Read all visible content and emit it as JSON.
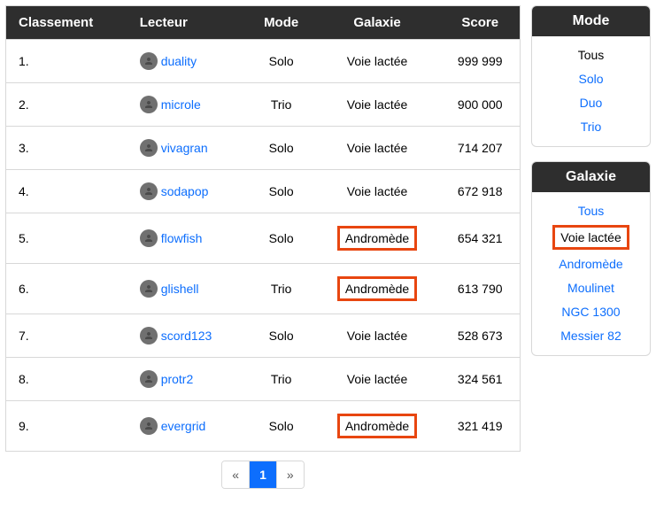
{
  "headers": [
    "Classement",
    "Lecteur",
    "Mode",
    "Galaxie",
    "Score"
  ],
  "rows": [
    {
      "rank": "1.",
      "player": "duality",
      "mode": "Solo",
      "galaxy": "Voie lactée",
      "galaxyHighlighted": false,
      "score": "999 999"
    },
    {
      "rank": "2.",
      "player": "microle",
      "mode": "Trio",
      "galaxy": "Voie lactée",
      "galaxyHighlighted": false,
      "score": "900 000"
    },
    {
      "rank": "3.",
      "player": "vivagran",
      "mode": "Solo",
      "galaxy": "Voie lactée",
      "galaxyHighlighted": false,
      "score": "714 207"
    },
    {
      "rank": "4.",
      "player": "sodapop",
      "mode": "Solo",
      "galaxy": "Voie lactée",
      "galaxyHighlighted": false,
      "score": "672 918"
    },
    {
      "rank": "5.",
      "player": "flowfish",
      "mode": "Solo",
      "galaxy": "Andromède",
      "galaxyHighlighted": true,
      "score": "654 321"
    },
    {
      "rank": "6.",
      "player": "glishell",
      "mode": "Trio",
      "galaxy": "Andromède",
      "galaxyHighlighted": true,
      "score": "613 790"
    },
    {
      "rank": "7.",
      "player": "scord123",
      "mode": "Solo",
      "galaxy": "Voie lactée",
      "galaxyHighlighted": false,
      "score": "528 673"
    },
    {
      "rank": "8.",
      "player": "protr2",
      "mode": "Trio",
      "galaxy": "Voie lactée",
      "galaxyHighlighted": false,
      "score": "324 561"
    },
    {
      "rank": "9.",
      "player": "evergrid",
      "mode": "Solo",
      "galaxy": "Andromède",
      "galaxyHighlighted": true,
      "score": "321 419"
    }
  ],
  "pager": {
    "prev": "«",
    "current": "1",
    "next": "»"
  },
  "filters": {
    "mode": {
      "title": "Mode",
      "items": [
        {
          "label": "Tous",
          "selected": true,
          "highlight": false
        },
        {
          "label": "Solo",
          "selected": false,
          "highlight": false
        },
        {
          "label": "Duo",
          "selected": false,
          "highlight": false
        },
        {
          "label": "Trio",
          "selected": false,
          "highlight": false
        }
      ]
    },
    "galaxy": {
      "title": "Galaxie",
      "items": [
        {
          "label": "Tous",
          "selected": false,
          "highlight": false
        },
        {
          "label": "Voie lactée",
          "selected": true,
          "highlight": true
        },
        {
          "label": "Andromède",
          "selected": false,
          "highlight": false
        },
        {
          "label": "Moulinet",
          "selected": false,
          "highlight": false
        },
        {
          "label": "NGC 1300",
          "selected": false,
          "highlight": false
        },
        {
          "label": "Messier 82",
          "selected": false,
          "highlight": false
        }
      ]
    }
  }
}
